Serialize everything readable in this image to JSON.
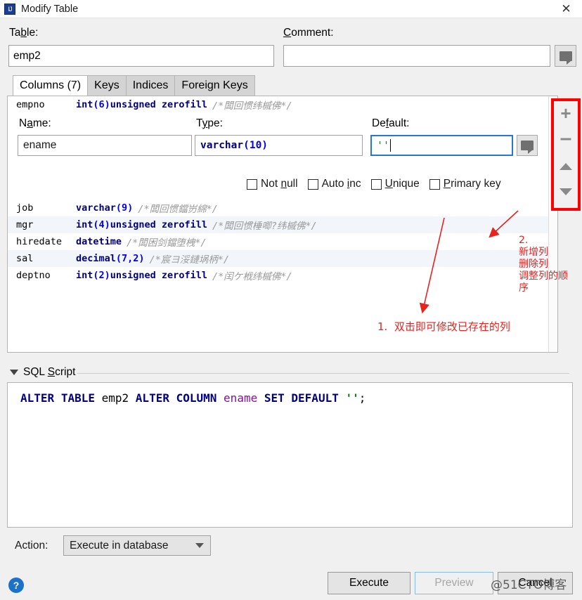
{
  "window": {
    "title": "Modify Table",
    "app_icon": "intellij-idea-icon",
    "close_label": "✕"
  },
  "table_field": {
    "label": "Table:",
    "label_prefix": "Ta",
    "label_mnemonic": "b",
    "label_suffix": "le:",
    "value": "emp2"
  },
  "comment_field": {
    "label": "Comment:",
    "label_mnemonic": "C",
    "label_suffix": "omment:",
    "value": "",
    "button_icon": "comment-balloon-icon"
  },
  "tabs": [
    {
      "label": "Columns (7)",
      "active": true
    },
    {
      "label": "Keys",
      "active": false
    },
    {
      "label": "Indices",
      "active": false
    },
    {
      "label": "Foreign Keys",
      "active": false
    }
  ],
  "columns": [
    {
      "name": "empno",
      "type": "int",
      "args": "(6)",
      "flags": " unsigned zerofill",
      "comment": "/*闆回惯纬槭佛*/",
      "alt": false
    },
    {
      "name": "job",
      "type": "varchar",
      "args": "(9)",
      "flags": "",
      "comment": "/*闆回惯鐺岃綿*/",
      "alt": false
    },
    {
      "name": "mgr",
      "type": "int",
      "args": "(4)",
      "flags": " unsigned zerofill",
      "comment": "/*闆回惯棰唧?纬槭佛*/",
      "alt": true
    },
    {
      "name": "hiredate",
      "type": "datetime",
      "args": "",
      "flags": "",
      "comment": "/*闆困剑鐺堕栧*/",
      "alt": false
    },
    {
      "name": "sal",
      "type": "decimal",
      "args": "(7,2)",
      "flags": "",
      "comment": "/*宸ヨ浽鏈埚柄*/",
      "alt": true
    },
    {
      "name": "deptno",
      "type": "int",
      "args": "(2)",
      "flags": " unsigned zerofill",
      "comment": "/*闰ケ栰纬槭佛*/",
      "alt": false
    }
  ],
  "editor": {
    "name_label_prefix": "N",
    "name_label_mnemonic": "a",
    "name_label_suffix": "me:",
    "name_value": "ename",
    "type_label_prefix": "T",
    "type_label_mnemonic": "y",
    "type_label_suffix": "pe:",
    "type_value_base": "varchar",
    "type_value_args": "(10)",
    "default_label_prefix": "De",
    "default_label_mnemonic": "f",
    "default_label_suffix": "ault:",
    "default_value": "''",
    "default_button_icon": "comment-balloon-icon",
    "checkboxes": [
      {
        "prefix": "Not ",
        "mnemonic": "n",
        "suffix": "ull",
        "checked": false
      },
      {
        "prefix": "Auto ",
        "mnemonic": "i",
        "suffix": "nc",
        "checked": false
      },
      {
        "prefix": "",
        "mnemonic": "U",
        "suffix": "nique",
        "checked": false
      },
      {
        "prefix": "",
        "mnemonic": "P",
        "suffix": "rimary key",
        "checked": false
      }
    ]
  },
  "row_toolbar": {
    "add_icon": "plus-icon",
    "remove_icon": "minus-icon",
    "move_up_icon": "triangle-up-icon",
    "move_down_icon": "triangle-down-icon",
    "highlight_color": "#ff0000"
  },
  "annotations": [
    {
      "id": "anno-1",
      "text": "1.  双击即可修改已存在的列",
      "color": "#e8221d"
    },
    {
      "id": "anno-2",
      "text": "2.\n新增列\n删除列\n调整列的顺\n序",
      "color": "#e8221d"
    }
  ],
  "sql_panel": {
    "header_prefix": "SQL ",
    "header_mnemonic": "S",
    "header_suffix": "cript",
    "collapse_icon": "triangle-down-icon",
    "statement_tokens": [
      {
        "t": "ALTER",
        "c": "kw"
      },
      {
        "t": " ",
        "c": "pun"
      },
      {
        "t": "TABLE",
        "c": "kw"
      },
      {
        "t": " ",
        "c": "pun"
      },
      {
        "t": "emp2",
        "c": "idn"
      },
      {
        "t": " ",
        "c": "pun"
      },
      {
        "t": "ALTER",
        "c": "kw"
      },
      {
        "t": " ",
        "c": "pun"
      },
      {
        "t": "COLUMN",
        "c": "kw"
      },
      {
        "t": " ",
        "c": "pun"
      },
      {
        "t": "ename",
        "c": "col"
      },
      {
        "t": " ",
        "c": "pun"
      },
      {
        "t": "SET",
        "c": "kw"
      },
      {
        "t": " ",
        "c": "pun"
      },
      {
        "t": "DEFAULT",
        "c": "kw"
      },
      {
        "t": " ",
        "c": "pun"
      },
      {
        "t": "''",
        "c": "str"
      },
      {
        "t": ";",
        "c": "pun"
      }
    ]
  },
  "footer": {
    "action_label": "Action:",
    "action_value": "Execute in database",
    "action_chevron_icon": "chevron-down-icon",
    "help_label": "?",
    "help_icon": "help-circle-icon",
    "execute_label": "Execute",
    "preview_label": "Preview",
    "cancel_label": "Cancel",
    "watermark": "@51CTO博客"
  }
}
